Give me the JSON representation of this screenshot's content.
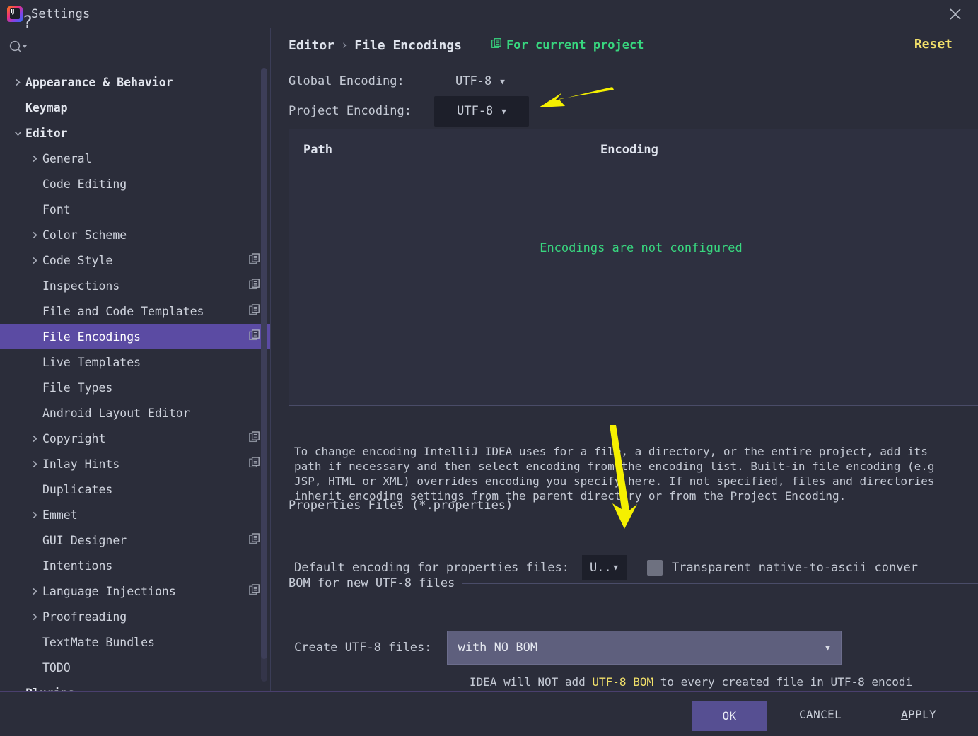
{
  "window": {
    "title": "Settings",
    "logo_text": "IJ",
    "close_icon": "close-icon"
  },
  "sidebar": {
    "search_placeholder": "",
    "search_icon": "search-icon",
    "items": [
      {
        "label": "Appearance & Behavior",
        "depth": 0,
        "arrow": "right",
        "bold": true,
        "copy": false,
        "selected": false
      },
      {
        "label": "Keymap",
        "depth": 0,
        "arrow": "none",
        "bold": true,
        "copy": false,
        "selected": false
      },
      {
        "label": "Editor",
        "depth": 0,
        "arrow": "down",
        "bold": true,
        "copy": false,
        "selected": false
      },
      {
        "label": "General",
        "depth": 1,
        "arrow": "right",
        "bold": false,
        "copy": false,
        "selected": false
      },
      {
        "label": "Code Editing",
        "depth": 1,
        "arrow": "none",
        "bold": false,
        "copy": false,
        "selected": false
      },
      {
        "label": "Font",
        "depth": 1,
        "arrow": "none",
        "bold": false,
        "copy": false,
        "selected": false
      },
      {
        "label": "Color Scheme",
        "depth": 1,
        "arrow": "right",
        "bold": false,
        "copy": false,
        "selected": false
      },
      {
        "label": "Code Style",
        "depth": 1,
        "arrow": "right",
        "bold": false,
        "copy": true,
        "selected": false
      },
      {
        "label": "Inspections",
        "depth": 1,
        "arrow": "none",
        "bold": false,
        "copy": true,
        "selected": false
      },
      {
        "label": "File and Code Templates",
        "depth": 1,
        "arrow": "none",
        "bold": false,
        "copy": true,
        "selected": false
      },
      {
        "label": "File Encodings",
        "depth": 1,
        "arrow": "none",
        "bold": false,
        "copy": true,
        "selected": true
      },
      {
        "label": "Live Templates",
        "depth": 1,
        "arrow": "none",
        "bold": false,
        "copy": false,
        "selected": false
      },
      {
        "label": "File Types",
        "depth": 1,
        "arrow": "none",
        "bold": false,
        "copy": false,
        "selected": false
      },
      {
        "label": "Android Layout Editor",
        "depth": 1,
        "arrow": "none",
        "bold": false,
        "copy": false,
        "selected": false
      },
      {
        "label": "Copyright",
        "depth": 1,
        "arrow": "right",
        "bold": false,
        "copy": true,
        "selected": false
      },
      {
        "label": "Inlay Hints",
        "depth": 1,
        "arrow": "right",
        "bold": false,
        "copy": true,
        "selected": false
      },
      {
        "label": "Duplicates",
        "depth": 1,
        "arrow": "none",
        "bold": false,
        "copy": false,
        "selected": false
      },
      {
        "label": "Emmet",
        "depth": 1,
        "arrow": "right",
        "bold": false,
        "copy": false,
        "selected": false
      },
      {
        "label": "GUI Designer",
        "depth": 1,
        "arrow": "none",
        "bold": false,
        "copy": true,
        "selected": false
      },
      {
        "label": "Intentions",
        "depth": 1,
        "arrow": "none",
        "bold": false,
        "copy": false,
        "selected": false
      },
      {
        "label": "Language Injections",
        "depth": 1,
        "arrow": "right",
        "bold": false,
        "copy": true,
        "selected": false
      },
      {
        "label": "Proofreading",
        "depth": 1,
        "arrow": "right",
        "bold": false,
        "copy": false,
        "selected": false
      },
      {
        "label": "TextMate Bundles",
        "depth": 1,
        "arrow": "none",
        "bold": false,
        "copy": false,
        "selected": false
      },
      {
        "label": "TODO",
        "depth": 1,
        "arrow": "none",
        "bold": false,
        "copy": false,
        "selected": false
      },
      {
        "label": "Plugins",
        "depth": 0,
        "arrow": "none",
        "bold": true,
        "copy": false,
        "selected": false
      }
    ]
  },
  "header": {
    "breadcrumb_parent": "Editor",
    "breadcrumb_sep": "›",
    "breadcrumb_current": "File Encodings",
    "for_current_project": "For current project",
    "for_current_project_icon": "copy-icon",
    "reset_label": "Reset"
  },
  "encodings": {
    "global_label": "Global Encoding:",
    "global_value": "UTF-8",
    "project_label": "Project Encoding:",
    "project_value": "UTF-8"
  },
  "table": {
    "columns": [
      "Path",
      "Encoding"
    ],
    "rows": [],
    "empty_message": "Encodings are not configured"
  },
  "description": {
    "line1": "To change encoding IntelliJ IDEA uses for a file, a directory, or the entire project, add its",
    "line2": "path if necessary and then select encoding from the encoding list. Built-in file encoding (e.g",
    "line3": "JSP, HTML or XML) overrides encoding you specify here. If not specified, files and directories",
    "line4": "inherit encoding settings from the parent directory or from the Project Encoding."
  },
  "properties_section": {
    "title": "Properties Files (*.properties)",
    "default_encoding_label": "Default encoding for properties files:",
    "default_encoding_value": "U..",
    "transparent_label": "Transparent native-to-ascii conver",
    "transparent_checked": false
  },
  "bom_section": {
    "title": "BOM for new UTF-8 files",
    "create_label": "Create UTF-8 files:",
    "create_value": "with NO BOM",
    "note_prefix": "IDEA will NOT add ",
    "note_highlight": "UTF-8 BOM",
    "note_suffix": " to every created file in UTF-8 encodi"
  },
  "footer": {
    "help_label": "?",
    "ok_label": "OK",
    "cancel_label": "CANCEL",
    "apply_label_underlined": "A",
    "apply_label_rest": "PPLY"
  },
  "colors": {
    "background": "#2b2d3a",
    "selection_purple": "#5b4ba3",
    "ok_button": "#564f92",
    "accent_green": "#38d77f",
    "accent_yellow": "#f2e06a",
    "annotation_arrow": "#f5f000"
  }
}
